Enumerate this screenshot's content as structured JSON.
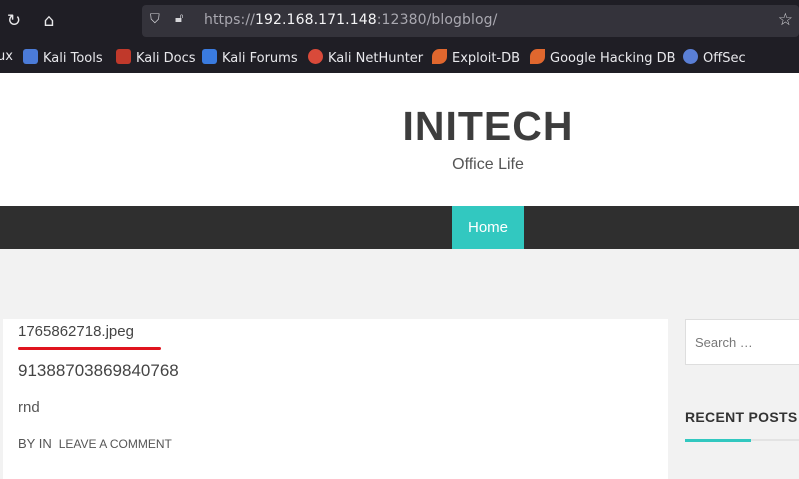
{
  "browser": {
    "url_prefix": "https://",
    "url_host": "192.168.171.148",
    "url_suffix": ":12380/blogblog/",
    "bookmarks": [
      {
        "label": "ux",
        "color": "#1f1e25"
      },
      {
        "label": "Kali Tools",
        "color": "#4b7bd8"
      },
      {
        "label": "Kali Docs",
        "color": "#c0392b"
      },
      {
        "label": "Kali Forums",
        "color": "#3a7be0"
      },
      {
        "label": "Kali NetHunter",
        "color": "#d94a3a"
      },
      {
        "label": "Exploit-DB",
        "color": "#e0672e"
      },
      {
        "label": "Google Hacking DB",
        "color": "#e0672e"
      },
      {
        "label": "OffSec",
        "color": "#5a7fd6"
      }
    ]
  },
  "site": {
    "title": "INITECH",
    "tagline": "Office Life",
    "menu_home": "Home"
  },
  "post": {
    "filename": "1765862718.jpeg",
    "title": "913887038698407 68",
    "body": "rnd",
    "meta_by": "BY IN",
    "meta_comment": "LEAVE A COMMENT"
  },
  "sidebar": {
    "search_placeholder": "Search …",
    "recent_posts": "RECENT POSTS"
  },
  "colors": {
    "accent": "#32c8c0",
    "highlight": "#e0141e"
  }
}
